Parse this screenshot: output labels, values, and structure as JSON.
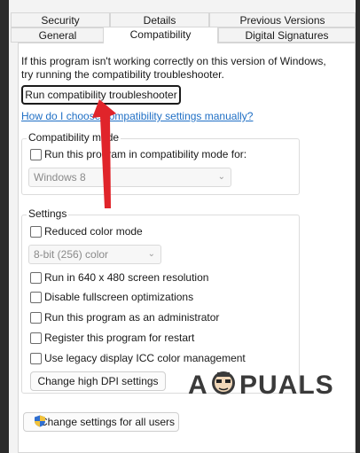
{
  "tabs_row1": [
    "Security",
    "Details",
    "Previous Versions"
  ],
  "tabs_row2": [
    "General",
    "Compatibility",
    "Digital Signatures"
  ],
  "info_line1": "If this program isn't working correctly on this version of Windows,",
  "info_line2": "try running the compatibility troubleshooter.",
  "troubleshooter_button": "Run compatibility troubleshooter",
  "manual_link": "How do I choose compatibility settings manually?",
  "compat_mode": {
    "label": "Compatibility mode",
    "checkbox": "Run this program in compatibility mode for:",
    "selected_os": "Windows 8"
  },
  "settings": {
    "label": "Settings",
    "reduced_color": "Reduced color mode",
    "color_option": "8-bit (256) color",
    "run_640": "Run in 640 x 480 screen resolution",
    "disable_fullscreen": "Disable fullscreen optimizations",
    "run_admin": "Run this program as an administrator",
    "register_restart": "Register this program for restart",
    "legacy_icc": "Use legacy display ICC color management",
    "high_dpi_button": "Change high DPI settings"
  },
  "all_users_button": "Change settings for all users",
  "watermark_text": "APPUALS",
  "colors": {
    "link": "#1f6fc5",
    "arrow": "#e0242a",
    "window_bg": "#f3f3f3"
  }
}
